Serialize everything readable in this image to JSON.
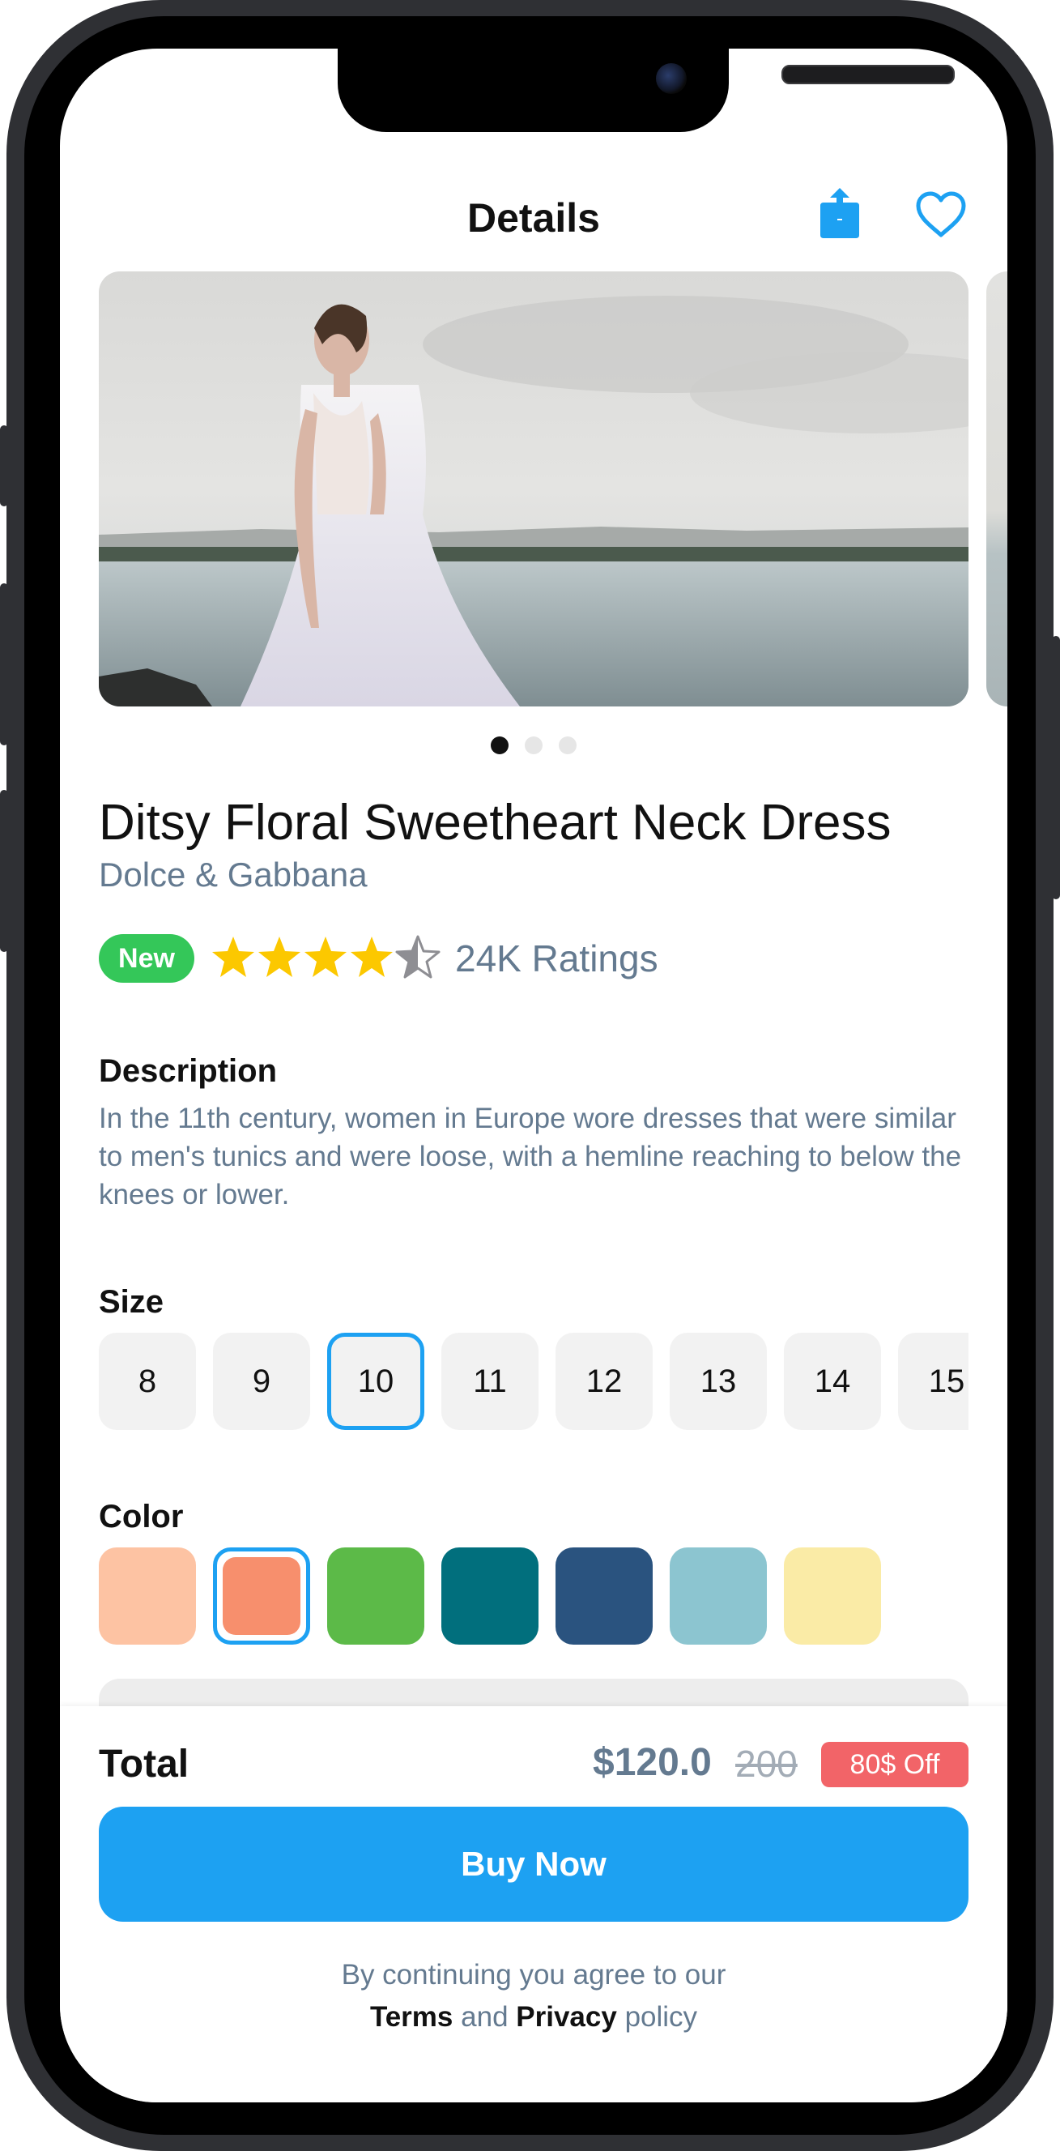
{
  "header": {
    "title": "Details",
    "share_icon": "share-icon",
    "favorite_icon": "heart-icon"
  },
  "carousel": {
    "image": "bride-on-beach-photo",
    "page_count": 3,
    "active_index": 0
  },
  "product": {
    "name": "Ditsy Floral Sweetheart Neck Dress",
    "brand": "Dolce & Gabbana",
    "badge": "New",
    "rating": 4.5,
    "ratings_text": "24K Ratings"
  },
  "description": {
    "heading": "Description",
    "text": "In the 11th century, women in Europe wore dresses that were similar to men's tunics and were loose, with a hemline reaching to below the knees or lower."
  },
  "size": {
    "heading": "Size",
    "options": [
      "8",
      "9",
      "10",
      "11",
      "12",
      "13",
      "14",
      "15"
    ],
    "selected": "10"
  },
  "color": {
    "heading": "Color",
    "options": [
      "#fdc3a3",
      "#f78f6d",
      "#5cba48",
      "#016f7d",
      "#2a537f",
      "#8cc5d0",
      "#faeba6"
    ],
    "selected_index": 1
  },
  "checkout": {
    "total_label": "Total",
    "price": "$120.0",
    "old_price": "200",
    "discount": "80$ Off",
    "buy_label": "Buy Now",
    "terms_prefix": "By continuing you agree to our",
    "terms_link": "Terms",
    "terms_and": "and",
    "privacy_link": "Privacy",
    "terms_suffix": "policy"
  },
  "colors": {
    "accent": "#1da1f2",
    "secondary_text": "#647a90",
    "badge_green": "#34c759",
    "discount_red": "#f26468",
    "star_gold": "#fcc800"
  }
}
